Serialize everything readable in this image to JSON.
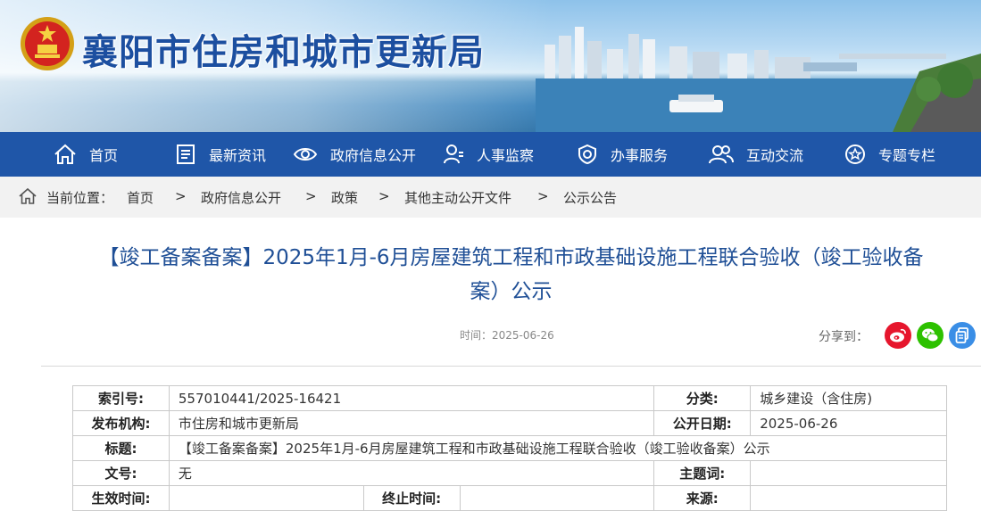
{
  "site": {
    "title": "襄阳市住房和城市更新局"
  },
  "nav": {
    "items": [
      {
        "label": "首页",
        "icon": "home-icon"
      },
      {
        "label": "最新资讯",
        "icon": "news-icon"
      },
      {
        "label": "政府信息公开",
        "icon": "eye-icon"
      },
      {
        "label": "人事监察",
        "icon": "person-icon"
      },
      {
        "label": "办事服务",
        "icon": "shield-icon"
      },
      {
        "label": "互动交流",
        "icon": "people-icon"
      },
      {
        "label": "专题专栏",
        "icon": "star-icon"
      }
    ]
  },
  "breadcrumb": {
    "prefix": "当前位置：",
    "items": [
      "首页",
      "政府信息公开",
      "政策",
      "其他主动公开文件",
      "公示公告"
    ],
    "separator": ">"
  },
  "article": {
    "title": "【竣工备案备案】2025年1月-6月房屋建筑工程和市政基础设施工程联合验收（竣工验收备案）公示",
    "time": "时间：2025-06-26",
    "share_label": "分享到："
  },
  "share": [
    {
      "name": "weibo-icon",
      "color": "#e6162d"
    },
    {
      "name": "wechat-icon",
      "color": "#2dc100"
    },
    {
      "name": "copy-icon",
      "color": "#3a8ee6"
    }
  ],
  "info": {
    "index_label": "索引号:",
    "index_value": "557010441/2025-16421",
    "category_label": "分类:",
    "category_value": "城乡建设（含住房)",
    "publisher_label": "发布机构:",
    "publisher_value": "市住房和城市更新局",
    "date_label": "公开日期:",
    "date_value": "2025-06-26",
    "title_label": "标题:",
    "title_value": "【竣工备案备案】2025年1月-6月房屋建筑工程和市政基础设施工程联合验收（竣工验收备案）公示",
    "doc_label": "文号:",
    "doc_value": "无",
    "keyword_label": "主题词:",
    "keyword_value": "",
    "effective_label": "生效时间:",
    "effective_value": "",
    "end_label": "终止时间:",
    "end_value": "",
    "source_label": "来源:",
    "source_value": ""
  },
  "colors": {
    "nav": "#1f56a8",
    "title": "#1f4f96",
    "brand": "#1c4fa0"
  }
}
